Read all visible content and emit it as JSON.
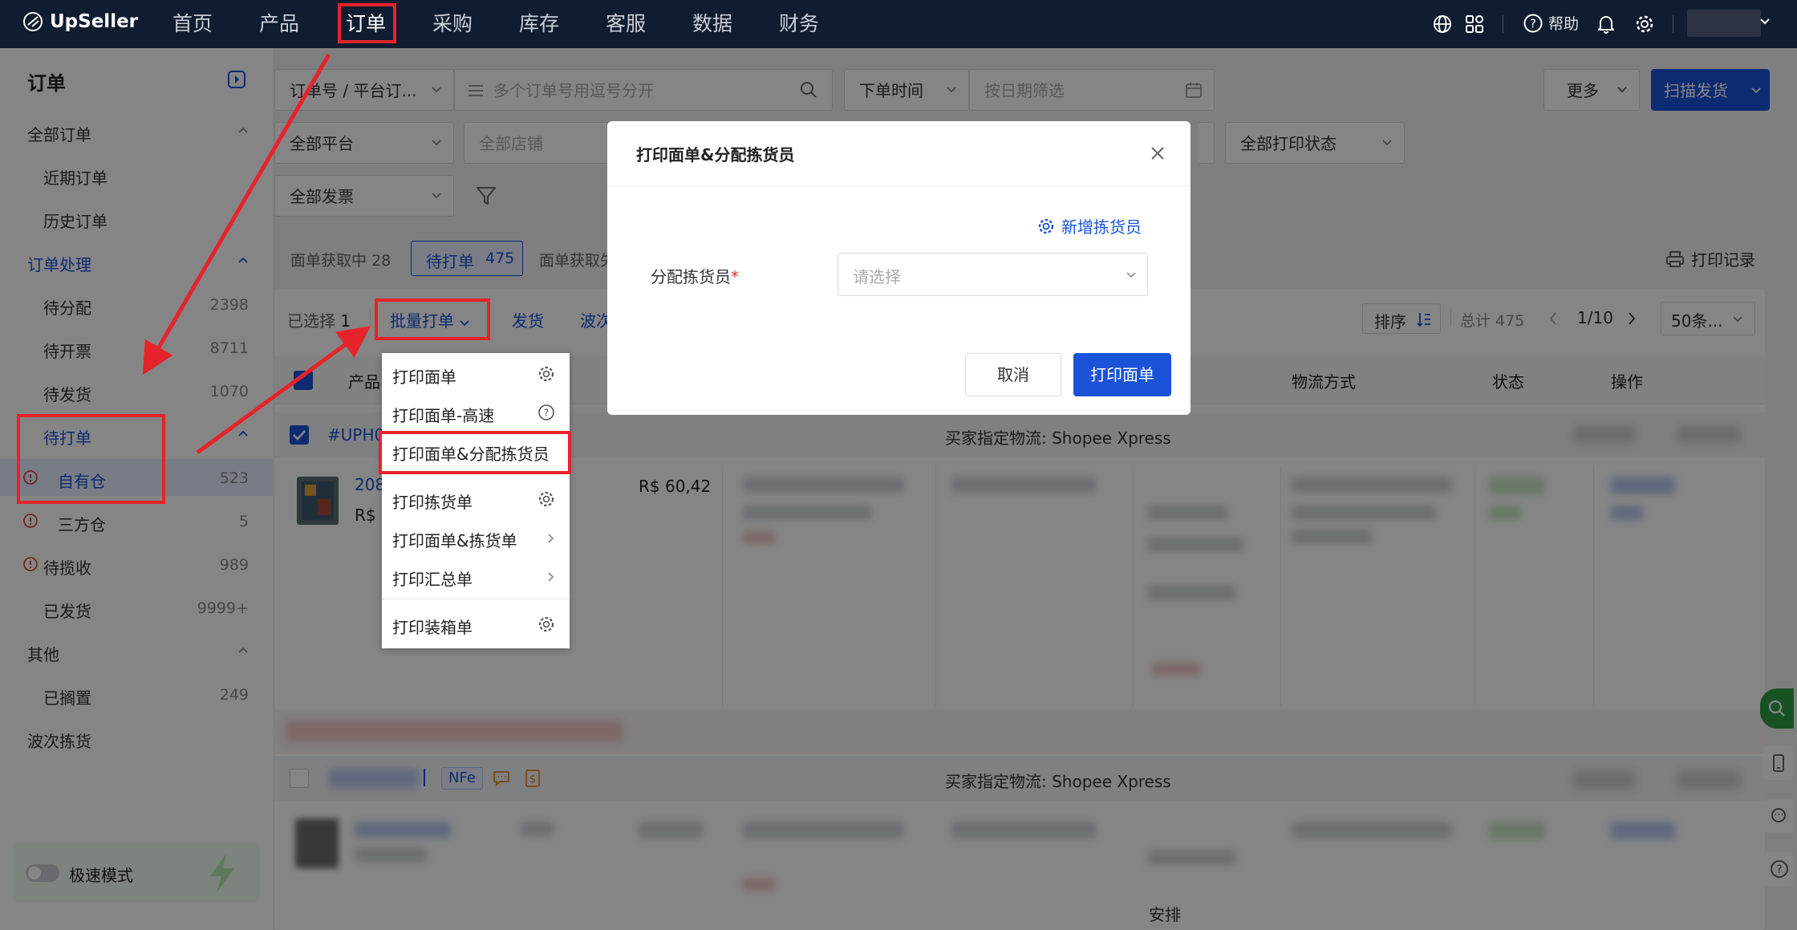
{
  "topnav": {
    "logo": "UpSeller",
    "items": [
      "首页",
      "产品",
      "订单",
      "采购",
      "库存",
      "客服",
      "数据",
      "财务"
    ],
    "help": "帮助"
  },
  "sidebar": {
    "title": "订单",
    "all_orders": "全部订单",
    "recent": "近期订单",
    "history": "历史订单",
    "processing": "订单处理",
    "to_assign": {
      "label": "待分配",
      "count": "2398"
    },
    "to_invoice": {
      "label": "待开票",
      "count": "8711"
    },
    "to_ship": {
      "label": "待发货",
      "count": "1070"
    },
    "to_print": "待打单",
    "own_wh": {
      "label": "自有仓",
      "count": "523"
    },
    "third_wh": {
      "label": "三方仓",
      "count": "5"
    },
    "to_collect": {
      "label": "待揽收",
      "count": "989"
    },
    "shipped": {
      "label": "已发货",
      "count": "9999+"
    },
    "other": "其他",
    "shelved": {
      "label": "已搁置",
      "count": "249"
    },
    "wave": "波次拣货",
    "speed_mode": "极速模式"
  },
  "filters": {
    "order_no_select": "订单号 / 平台订...",
    "order_no_placeholder": "多个订单号用逗号分开",
    "time_select": "下单时间",
    "date_placeholder": "按日期筛选",
    "more": "更多",
    "scan_ship": "扫描发货",
    "platform": "全部平台",
    "store": "全部店铺",
    "print_status": "全部打印状态",
    "invoice": "全部发票"
  },
  "status_tabs": {
    "fetching": {
      "label": "面单获取中",
      "count": "28"
    },
    "to_print": {
      "label": "待打单",
      "count": "475"
    },
    "fetch_fail": "面单获取失",
    "print_log": "打印记录"
  },
  "toolbar": {
    "selected": "已选择",
    "selected_count": "1",
    "batch_print": "批量打单",
    "ship": "发货",
    "wave": "波次",
    "sort": "排序",
    "total": "总计 475",
    "page": "1/10",
    "page_size": "50条..."
  },
  "table": {
    "col_product": "产品",
    "col_logistics": "物流方式",
    "col_status": "状态",
    "col_action": "操作",
    "order1_id": "#UPH0",
    "order1_logistics": "买家指定物流: Shopee Xpress",
    "item1_id": "208",
    "item1_price_prefix": "R$",
    "item1_price": "R$ 60,42",
    "order2_logistics": "买家指定物流: Shopee Xpress",
    "order2_tag": "NFe",
    "arrange": "安排"
  },
  "menu": {
    "items": [
      "打印面单",
      "打印面单-高速",
      "打印面单&分配拣货员",
      "打印拣货单",
      "打印面单&拣货单",
      "打印汇总单",
      "打印装箱单"
    ]
  },
  "modal": {
    "title": "打印面单&分配拣货员",
    "add_picker": "新增拣货员",
    "field_label": "分配拣货员",
    "required_mark": "*",
    "select_placeholder": "请选择",
    "cancel": "取消",
    "confirm": "打印面单"
  },
  "colors": {
    "nav_bg": "#101c2f",
    "primary": "#1a53d8",
    "highlight_red": "#e6232a",
    "warn": "#e03131"
  }
}
